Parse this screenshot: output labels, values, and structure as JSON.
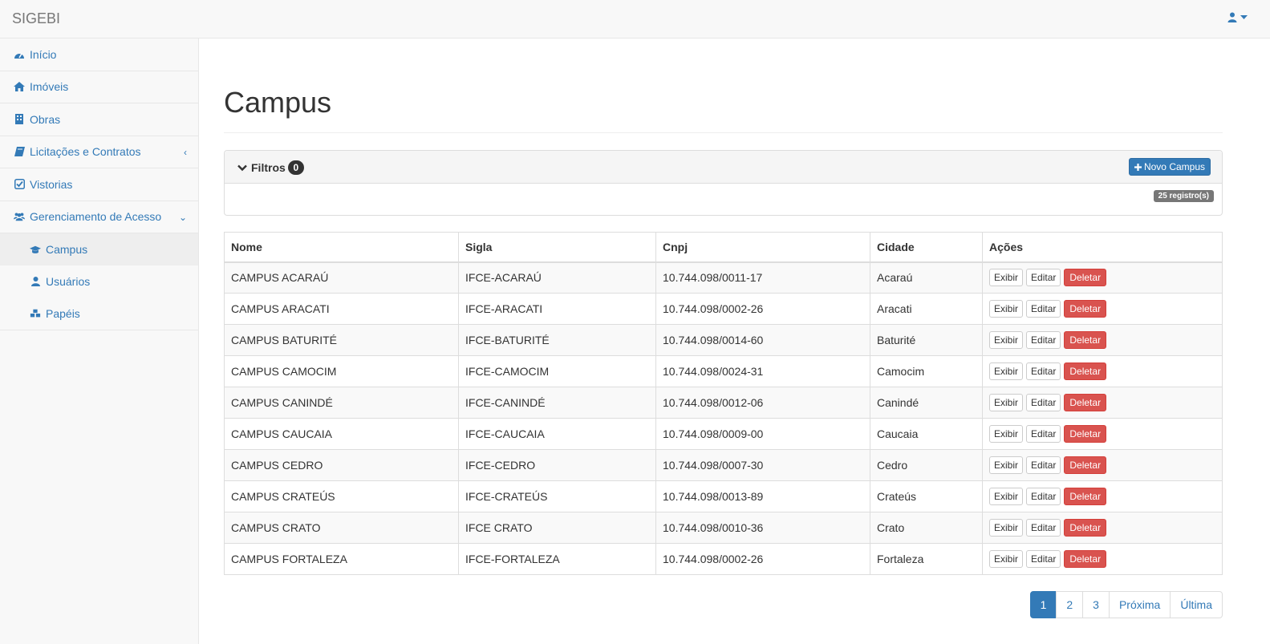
{
  "app": {
    "brand": "SIGEBI"
  },
  "sidebar": {
    "items": [
      {
        "label": "Início",
        "icon": "dashboard-icon"
      },
      {
        "label": "Imóveis",
        "icon": "home-icon"
      },
      {
        "label": "Obras",
        "icon": "building-icon"
      },
      {
        "label": "Licitações e Contratos",
        "icon": "book-icon",
        "chevron": "‹"
      },
      {
        "label": "Vistorias",
        "icon": "check-square-icon"
      },
      {
        "label": "Gerenciamento de Acesso",
        "icon": "users-icon",
        "chevron": "⌄"
      }
    ],
    "subitems": [
      {
        "label": "Campus",
        "icon": "graduation-cap-icon",
        "active": true
      },
      {
        "label": "Usuários",
        "icon": "user-icon"
      },
      {
        "label": "Papéis",
        "icon": "cubes-icon"
      }
    ]
  },
  "page": {
    "title": "Campus"
  },
  "filters": {
    "label": "Filtros",
    "count": "0",
    "new_button": "Novo Campus",
    "records": "25 registro(s)"
  },
  "table": {
    "headers": [
      "Nome",
      "Sigla",
      "Cnpj",
      "Cidade",
      "Ações"
    ],
    "rows": [
      [
        "CAMPUS ACARAÚ",
        "IFCE-ACARAÚ",
        "10.744.098/0011-17",
        "Acaraú"
      ],
      [
        "CAMPUS ARACATI",
        "IFCE-ARACATI",
        "10.744.098/0002-26",
        "Aracati"
      ],
      [
        "CAMPUS BATURITÉ",
        "IFCE-BATURITÉ",
        "10.744.098/0014-60",
        "Baturité"
      ],
      [
        "CAMPUS CAMOCIM",
        "IFCE-CAMOCIM",
        "10.744.098/0024-31",
        "Camocim"
      ],
      [
        "CAMPUS CANINDÉ",
        "IFCE-CANINDÉ",
        "10.744.098/0012-06",
        "Canindé"
      ],
      [
        "CAMPUS CAUCAIA",
        "IFCE-CAUCAIA",
        "10.744.098/0009-00",
        "Caucaia"
      ],
      [
        "CAMPUS CEDRO",
        "IFCE-CEDRO",
        "10.744.098/0007-30",
        "Cedro"
      ],
      [
        "CAMPUS CRATEÚS",
        "IFCE-CRATEÚS",
        "10.744.098/0013-89",
        "Crateús"
      ],
      [
        "CAMPUS CRATO",
        "IFCE CRATO",
        "10.744.098/0010-36",
        "Crato"
      ],
      [
        "CAMPUS FORTALEZA",
        "IFCE-FORTALEZA",
        "10.744.098/0002-26",
        "Fortaleza"
      ]
    ],
    "actions": {
      "view": "Exibir",
      "edit": "Editar",
      "delete": "Deletar"
    }
  },
  "pagination": {
    "pages": [
      "1",
      "2",
      "3"
    ],
    "next": "Próxima",
    "last": "Última",
    "current": "1"
  },
  "colors": {
    "primary": "#337ab7",
    "danger": "#d9534f",
    "dark_badge": "#333333",
    "gray_badge": "#777777"
  }
}
